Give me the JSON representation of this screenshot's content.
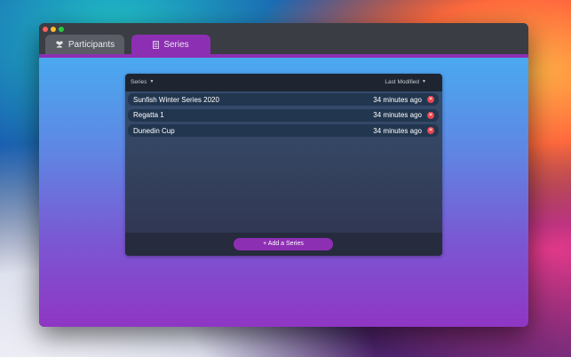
{
  "tabs": [
    {
      "label": "Participants",
      "icon": "people-icon"
    },
    {
      "label": "Series",
      "icon": "list-icon"
    }
  ],
  "active_tab": "Series",
  "table": {
    "col_series": "Series",
    "col_modified": "Last Modified",
    "rows": [
      {
        "name": "Sunfish Winter Series 2020",
        "modified": "34 minutes ago"
      },
      {
        "name": "Regatta 1",
        "modified": "34 minutes ago"
      },
      {
        "name": "Dunedin Cup",
        "modified": "34 minutes ago"
      }
    ]
  },
  "add_button_label": "+ Add a Series",
  "colors": {
    "accent": "#8d2fb3",
    "delete": "#e8444d",
    "gradient_top": "#4aa9f0",
    "gradient_bottom": "#8f36c4"
  }
}
